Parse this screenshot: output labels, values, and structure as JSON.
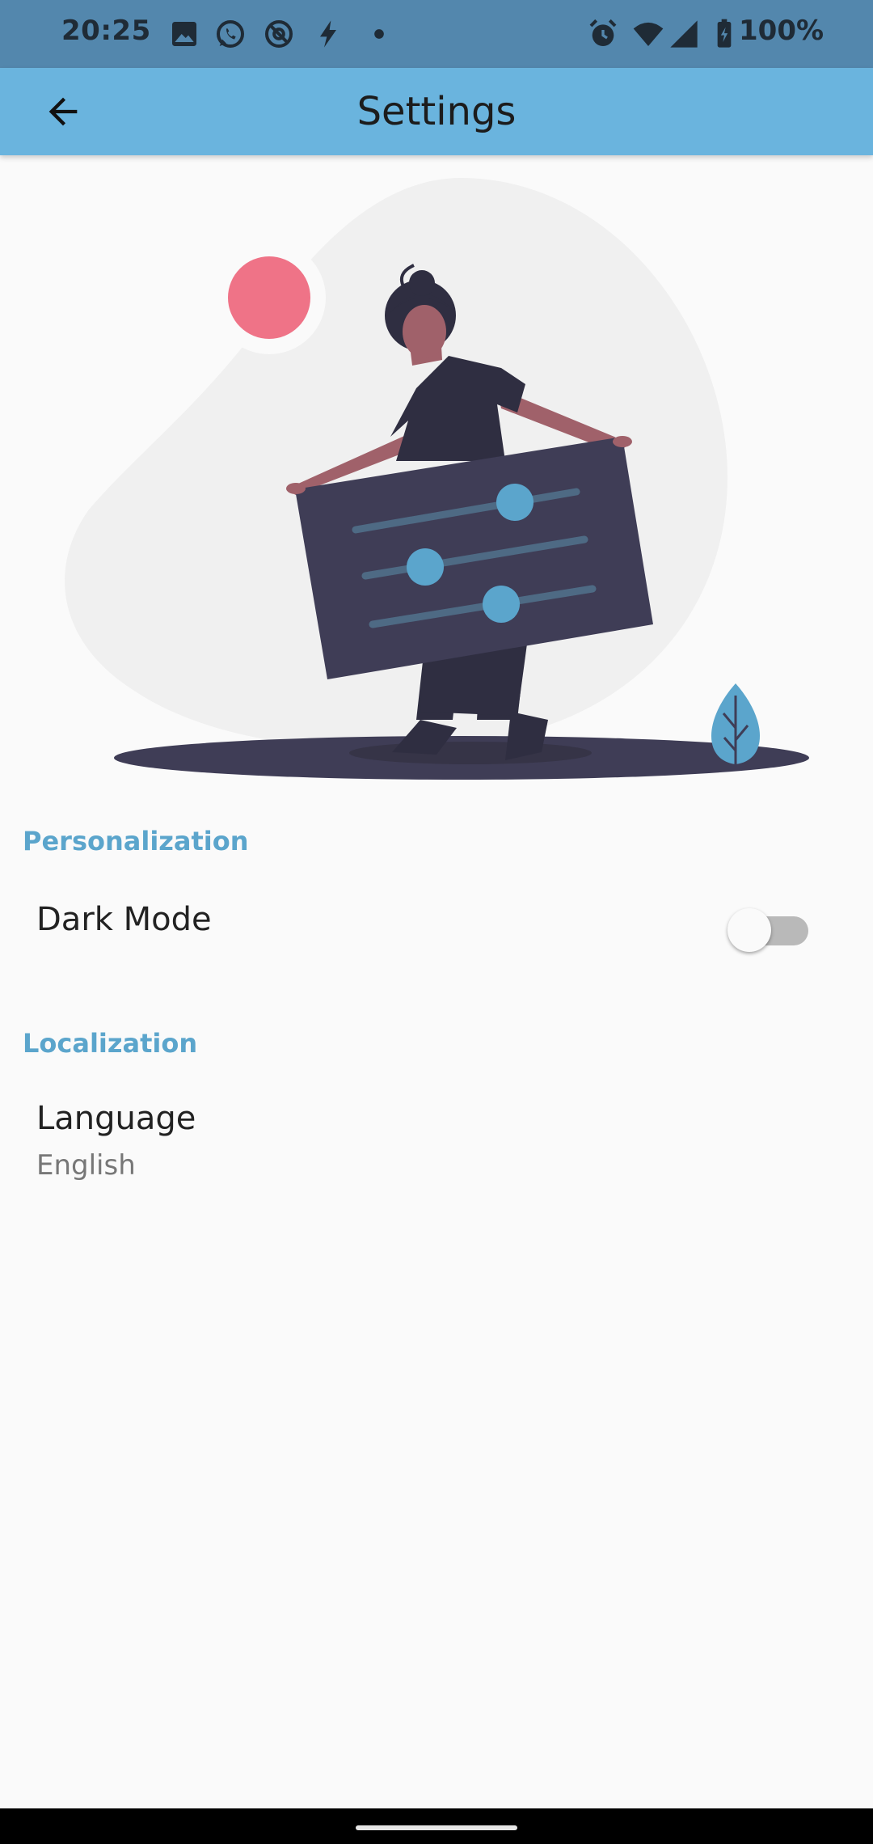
{
  "status_bar": {
    "time": "20:25",
    "battery": "100%",
    "left_icons": [
      "image-icon",
      "whatsapp-icon",
      "at-sign-icon",
      "flash-icon",
      "dot-icon"
    ],
    "right_icons": [
      "alarm-icon",
      "wifi-icon",
      "signal-icon",
      "battery-icon"
    ]
  },
  "app_bar": {
    "title": "Settings",
    "back_icon": "arrow-back-icon",
    "color": "#6ab4de"
  },
  "illustration": {
    "name": "settings-illustration"
  },
  "sections": {
    "personalization": {
      "header": "Personalization",
      "dark_mode_label": "Dark Mode",
      "dark_mode_enabled": false
    },
    "localization": {
      "header": "Localization",
      "language_label": "Language",
      "language_value": "English"
    }
  },
  "colors": {
    "accent": "#5ba5cc",
    "status_bar": "#5387ad"
  }
}
